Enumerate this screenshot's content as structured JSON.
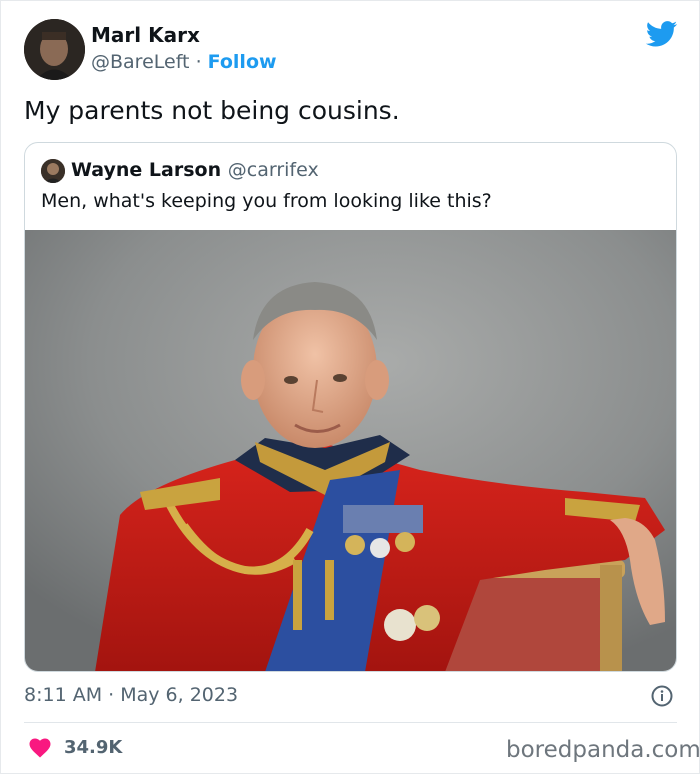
{
  "author": {
    "name": "Marl Karx",
    "handle": "@BareLeft",
    "separator": "·",
    "follow_label": "Follow"
  },
  "tweet_text": "My parents not being cousins.",
  "quoted_tweet": {
    "author_name": "Wayne Larson",
    "author_handle": "@carrifex",
    "text": "Men, what's keeping you from looking like this?",
    "media": "portrait-photo"
  },
  "meta": {
    "timestamp": "8:11 AM · May 6, 2023"
  },
  "engagement": {
    "likes": "34.9K"
  },
  "watermark": "boredpanda.com",
  "icons": [
    "twitter-bird-icon",
    "info-icon",
    "heart-icon"
  ],
  "colors": {
    "accent": "#1d9bf0",
    "like": "#f91880",
    "text": "#0f1419",
    "secondary": "#536471"
  }
}
